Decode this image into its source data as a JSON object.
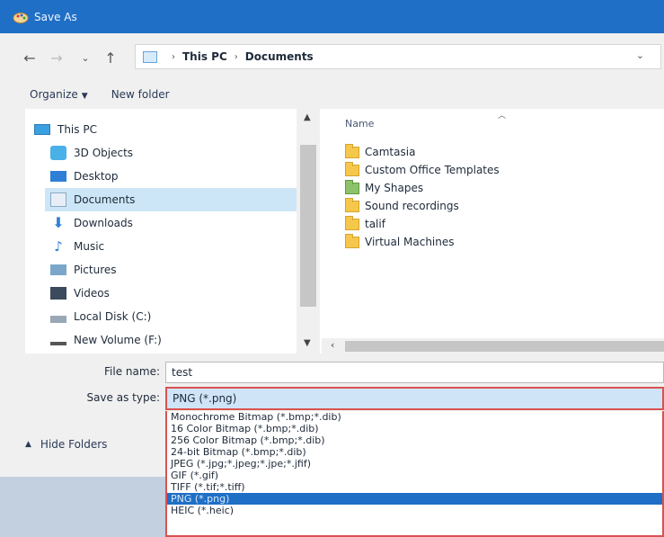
{
  "window": {
    "title": "Save As"
  },
  "address": {
    "crumbs": [
      "This PC",
      "Documents"
    ]
  },
  "toolbar": {
    "organize": "Organize",
    "new_folder": "New folder"
  },
  "nav": {
    "items": [
      {
        "label": "This PC",
        "icon": "pc-icon",
        "selected": false
      },
      {
        "label": "3D Objects",
        "icon": "3d-objects-icon",
        "selected": false
      },
      {
        "label": "Desktop",
        "icon": "desktop-icon",
        "selected": false
      },
      {
        "label": "Documents",
        "icon": "documents-icon",
        "selected": true
      },
      {
        "label": "Downloads",
        "icon": "downloads-icon",
        "selected": false
      },
      {
        "label": "Music",
        "icon": "music-icon",
        "selected": false
      },
      {
        "label": "Pictures",
        "icon": "pictures-icon",
        "selected": false
      },
      {
        "label": "Videos",
        "icon": "videos-icon",
        "selected": false
      },
      {
        "label": "Local Disk (C:)",
        "icon": "disk-icon",
        "selected": false
      },
      {
        "label": "New Volume (F:)",
        "icon": "disk-icon",
        "selected": false
      }
    ]
  },
  "files": {
    "column_name": "Name",
    "items": [
      {
        "label": "Camtasia",
        "icon": "folder-icon"
      },
      {
        "label": "Custom Office Templates",
        "icon": "folder-icon"
      },
      {
        "label": "My Shapes",
        "icon": "special-folder-icon"
      },
      {
        "label": "Sound recordings",
        "icon": "folder-icon"
      },
      {
        "label": "talif",
        "icon": "folder-icon"
      },
      {
        "label": "Virtual Machines",
        "icon": "folder-icon"
      }
    ]
  },
  "form": {
    "file_name_label": "File name:",
    "file_name_value": "test",
    "save_type_label": "Save as type:",
    "save_type_value": "PNG (*.png)",
    "type_options": [
      "Monochrome Bitmap (*.bmp;*.dib)",
      "16 Color Bitmap (*.bmp;*.dib)",
      "256 Color Bitmap (*.bmp;*.dib)",
      "24-bit Bitmap (*.bmp;*.dib)",
      "JPEG (*.jpg;*.jpeg;*.jpe;*.jfif)",
      "GIF (*.gif)",
      "TIFF (*.tif;*.tiff)",
      "PNG (*.png)",
      "HEIC (*.heic)"
    ],
    "selected_option": "PNG (*.png)"
  },
  "hide_folders": "Hide Folders",
  "colors": {
    "title_bar": "#1f6fc6",
    "selection": "#cde6f7",
    "highlight": "#1f6fc6",
    "focus_border": "#d9534f"
  }
}
